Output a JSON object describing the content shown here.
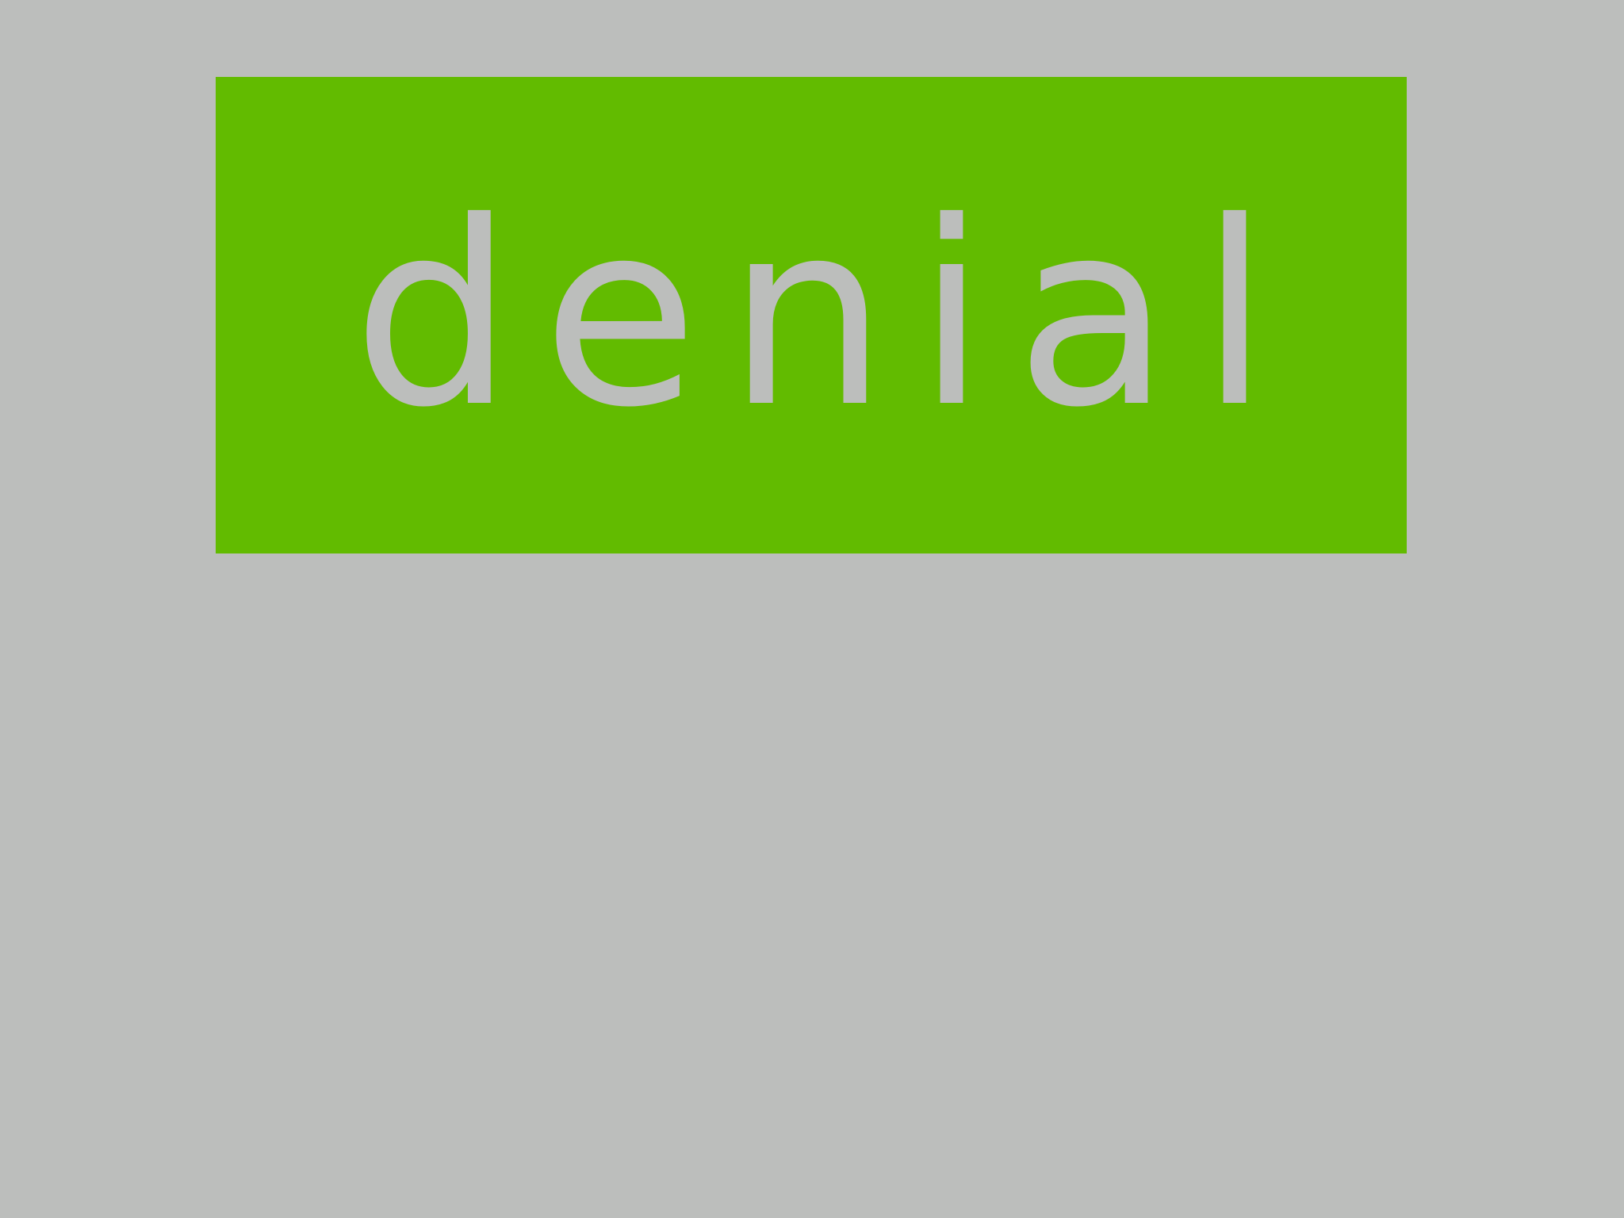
{
  "card": {
    "word": "denial",
    "background_color": "#62bb00",
    "text_color": "#bcbebc"
  },
  "page": {
    "background_color": "#bcbebc"
  }
}
